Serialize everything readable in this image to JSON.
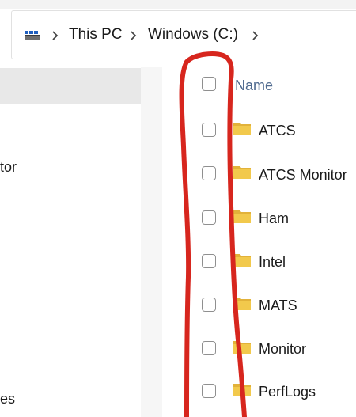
{
  "breadcrumb": {
    "items": [
      "This PC",
      "Windows (C:)"
    ]
  },
  "navigation_pane": {
    "visible_fragments": [
      "tor",
      "es"
    ]
  },
  "file_list": {
    "column_header": "Name",
    "rows": [
      {
        "name": "ATCS"
      },
      {
        "name": "ATCS Monitor"
      },
      {
        "name": "Ham"
      },
      {
        "name": "Intel"
      },
      {
        "name": "MATS"
      },
      {
        "name": "Monitor"
      },
      {
        "name": "PerfLogs"
      }
    ]
  },
  "colors": {
    "folder": "#F2C94C",
    "folder_dark": "#E2B23A",
    "annotation_stroke": "#D7261E",
    "header_text": "#4F6A8F",
    "selected_nav_bg": "#E8E8E8"
  },
  "icons": {
    "drive": "drive-icon",
    "chevron": "chevron-right-icon",
    "folder": "folder-icon",
    "checkbox": "checkbox"
  }
}
